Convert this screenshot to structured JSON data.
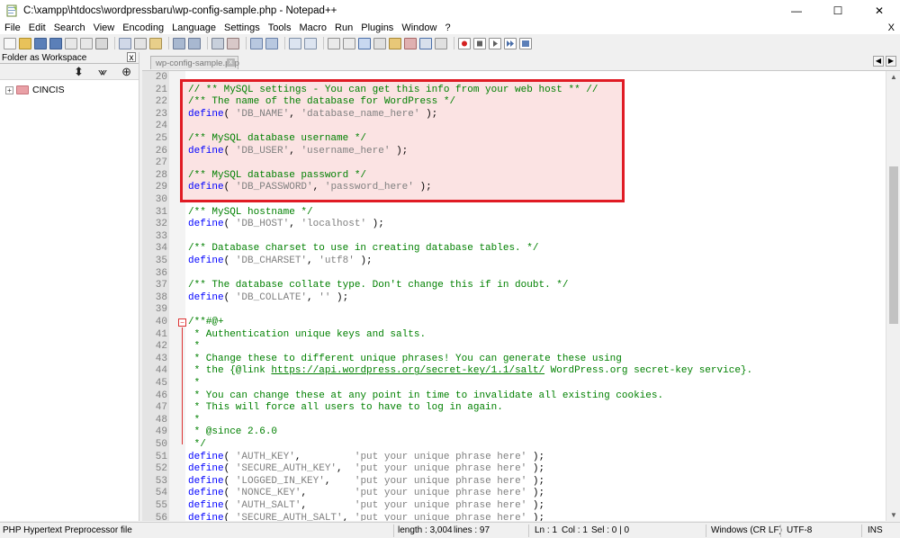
{
  "window": {
    "title": "C:\\xampp\\htdocs\\wordpressbaru\\wp-config-sample.php - Notepad++",
    "minimize": "—",
    "maximize": "☐",
    "close": "✕"
  },
  "menu": {
    "items": [
      "File",
      "Edit",
      "Search",
      "View",
      "Encoding",
      "Language",
      "Settings",
      "Tools",
      "Macro",
      "Run",
      "Plugins",
      "Window",
      "?"
    ],
    "close": "X"
  },
  "panel": {
    "title": "Folder as Workspace",
    "close": "x",
    "tree": [
      {
        "label": "CINCIS",
        "expander": "+"
      }
    ]
  },
  "tab": {
    "label": "wp-config-sample.php",
    "close": "x"
  },
  "editor": {
    "lines": [
      {
        "n": "20",
        "segs": []
      },
      {
        "n": "21",
        "segs": [
          {
            "t": "// ** MySQL settings - You can get this info from your web host ** //",
            "c": "c-comment"
          }
        ]
      },
      {
        "n": "22",
        "segs": [
          {
            "t": "/** The name of the database for WordPress */",
            "c": "c-comment"
          }
        ]
      },
      {
        "n": "23",
        "segs": [
          {
            "t": "define",
            "c": "c-kw"
          },
          {
            "t": "( ",
            "c": ""
          },
          {
            "t": "'DB_NAME'",
            "c": "c-str"
          },
          {
            "t": ", ",
            "c": ""
          },
          {
            "t": "'database_name_here'",
            "c": "c-str"
          },
          {
            "t": " );",
            "c": ""
          }
        ]
      },
      {
        "n": "24",
        "segs": []
      },
      {
        "n": "25",
        "segs": [
          {
            "t": "/** MySQL database username */",
            "c": "c-comment"
          }
        ]
      },
      {
        "n": "26",
        "segs": [
          {
            "t": "define",
            "c": "c-kw"
          },
          {
            "t": "( ",
            "c": ""
          },
          {
            "t": "'DB_USER'",
            "c": "c-str"
          },
          {
            "t": ", ",
            "c": ""
          },
          {
            "t": "'username_here'",
            "c": "c-str"
          },
          {
            "t": " );",
            "c": ""
          }
        ]
      },
      {
        "n": "27",
        "segs": []
      },
      {
        "n": "28",
        "segs": [
          {
            "t": "/** MySQL database password */",
            "c": "c-comment"
          }
        ]
      },
      {
        "n": "29",
        "segs": [
          {
            "t": "define",
            "c": "c-kw"
          },
          {
            "t": "( ",
            "c": ""
          },
          {
            "t": "'DB_PASSWORD'",
            "c": "c-str"
          },
          {
            "t": ", ",
            "c": ""
          },
          {
            "t": "'password_here'",
            "c": "c-str"
          },
          {
            "t": " );",
            "c": ""
          }
        ]
      },
      {
        "n": "30",
        "segs": []
      },
      {
        "n": "31",
        "segs": [
          {
            "t": "/** MySQL hostname */",
            "c": "c-comment"
          }
        ]
      },
      {
        "n": "32",
        "segs": [
          {
            "t": "define",
            "c": "c-kw"
          },
          {
            "t": "( ",
            "c": ""
          },
          {
            "t": "'DB_HOST'",
            "c": "c-str"
          },
          {
            "t": ", ",
            "c": ""
          },
          {
            "t": "'localhost'",
            "c": "c-str"
          },
          {
            "t": " );",
            "c": ""
          }
        ]
      },
      {
        "n": "33",
        "segs": []
      },
      {
        "n": "34",
        "segs": [
          {
            "t": "/** Database charset to use in creating database tables. */",
            "c": "c-comment"
          }
        ]
      },
      {
        "n": "35",
        "segs": [
          {
            "t": "define",
            "c": "c-kw"
          },
          {
            "t": "( ",
            "c": ""
          },
          {
            "t": "'DB_CHARSET'",
            "c": "c-str"
          },
          {
            "t": ", ",
            "c": ""
          },
          {
            "t": "'utf8'",
            "c": "c-str"
          },
          {
            "t": " );",
            "c": ""
          }
        ]
      },
      {
        "n": "36",
        "segs": []
      },
      {
        "n": "37",
        "segs": [
          {
            "t": "/** The database collate type. Don't change this if in doubt. */",
            "c": "c-comment"
          }
        ]
      },
      {
        "n": "38",
        "segs": [
          {
            "t": "define",
            "c": "c-kw"
          },
          {
            "t": "( ",
            "c": ""
          },
          {
            "t": "'DB_COLLATE'",
            "c": "c-str"
          },
          {
            "t": ", ",
            "c": ""
          },
          {
            "t": "''",
            "c": "c-str"
          },
          {
            "t": " );",
            "c": ""
          }
        ]
      },
      {
        "n": "39",
        "segs": []
      },
      {
        "n": "40",
        "segs": [
          {
            "t": "/**#@+",
            "c": "c-comment"
          }
        ]
      },
      {
        "n": "41",
        "segs": [
          {
            "t": " * Authentication unique keys and salts.",
            "c": "c-comment"
          }
        ]
      },
      {
        "n": "42",
        "segs": [
          {
            "t": " *",
            "c": "c-comment"
          }
        ]
      },
      {
        "n": "43",
        "segs": [
          {
            "t": " * Change these to different unique phrases! You can generate these using",
            "c": "c-comment"
          }
        ]
      },
      {
        "n": "44",
        "segs": [
          {
            "t": " * the {@link ",
            "c": "c-comment"
          },
          {
            "t": "https://api.wordpress.org/secret-key/1.1/salt/",
            "c": "c-link"
          },
          {
            "t": " WordPress.org secret-key service}.",
            "c": "c-comment"
          }
        ]
      },
      {
        "n": "45",
        "segs": [
          {
            "t": " *",
            "c": "c-comment"
          }
        ]
      },
      {
        "n": "46",
        "segs": [
          {
            "t": " * You can change these at any point in time to invalidate all existing cookies.",
            "c": "c-comment"
          }
        ]
      },
      {
        "n": "47",
        "segs": [
          {
            "t": " * This will force all users to have to log in again.",
            "c": "c-comment"
          }
        ]
      },
      {
        "n": "48",
        "segs": [
          {
            "t": " *",
            "c": "c-comment"
          }
        ]
      },
      {
        "n": "49",
        "segs": [
          {
            "t": " * @since 2.6.0",
            "c": "c-comment"
          }
        ]
      },
      {
        "n": "50",
        "segs": [
          {
            "t": " */",
            "c": "c-comment"
          }
        ]
      },
      {
        "n": "51",
        "segs": [
          {
            "t": "define",
            "c": "c-kw"
          },
          {
            "t": "( ",
            "c": ""
          },
          {
            "t": "'AUTH_KEY'",
            "c": "c-str"
          },
          {
            "t": ",         ",
            "c": ""
          },
          {
            "t": "'put your unique phrase here'",
            "c": "c-str"
          },
          {
            "t": " );",
            "c": ""
          }
        ]
      },
      {
        "n": "52",
        "segs": [
          {
            "t": "define",
            "c": "c-kw"
          },
          {
            "t": "( ",
            "c": ""
          },
          {
            "t": "'SECURE_AUTH_KEY'",
            "c": "c-str"
          },
          {
            "t": ",  ",
            "c": ""
          },
          {
            "t": "'put your unique phrase here'",
            "c": "c-str"
          },
          {
            "t": " );",
            "c": ""
          }
        ]
      },
      {
        "n": "53",
        "segs": [
          {
            "t": "define",
            "c": "c-kw"
          },
          {
            "t": "( ",
            "c": ""
          },
          {
            "t": "'LOGGED_IN_KEY'",
            "c": "c-str"
          },
          {
            "t": ",    ",
            "c": ""
          },
          {
            "t": "'put your unique phrase here'",
            "c": "c-str"
          },
          {
            "t": " );",
            "c": ""
          }
        ]
      },
      {
        "n": "54",
        "segs": [
          {
            "t": "define",
            "c": "c-kw"
          },
          {
            "t": "( ",
            "c": ""
          },
          {
            "t": "'NONCE_KEY'",
            "c": "c-str"
          },
          {
            "t": ",        ",
            "c": ""
          },
          {
            "t": "'put your unique phrase here'",
            "c": "c-str"
          },
          {
            "t": " );",
            "c": ""
          }
        ]
      },
      {
        "n": "55",
        "segs": [
          {
            "t": "define",
            "c": "c-kw"
          },
          {
            "t": "( ",
            "c": ""
          },
          {
            "t": "'AUTH_SALT'",
            "c": "c-str"
          },
          {
            "t": ",        ",
            "c": ""
          },
          {
            "t": "'put your unique phrase here'",
            "c": "c-str"
          },
          {
            "t": " );",
            "c": ""
          }
        ]
      },
      {
        "n": "56",
        "segs": [
          {
            "t": "define",
            "c": "c-kw"
          },
          {
            "t": "( ",
            "c": ""
          },
          {
            "t": "'SECURE_AUTH_SALT'",
            "c": "c-str"
          },
          {
            "t": ", ",
            "c": ""
          },
          {
            "t": "'put your unique phrase here'",
            "c": "c-str"
          },
          {
            "t": " );",
            "c": ""
          }
        ]
      }
    ]
  },
  "status": {
    "filetype": "PHP Hypertext Preprocessor file",
    "length": "length : 3,004",
    "lines": "lines : 97",
    "ln": "Ln : 1",
    "col": "Col : 1",
    "sel": "Sel : 0 | 0",
    "eol": "Windows (CR LF)",
    "encoding": "UTF-8",
    "mode": "INS"
  },
  "colors": {
    "highlight_border": "#e01b24",
    "highlight_fill": "#fbe3e3",
    "comment": "#008000",
    "keyword": "#0000ff",
    "string": "#808080"
  }
}
